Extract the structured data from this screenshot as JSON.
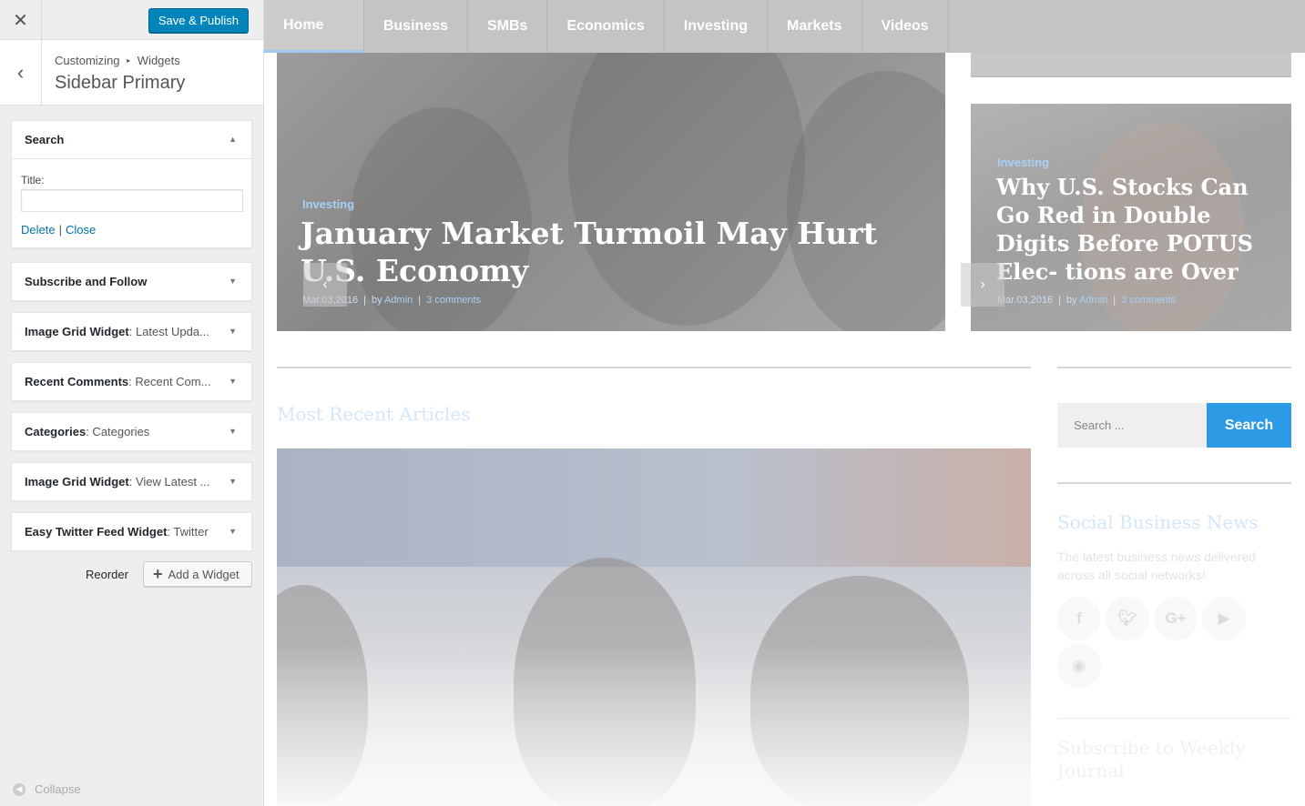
{
  "customizer": {
    "publish_label": "Save & Publish",
    "close_glyph": "✕",
    "back_glyph": "‹",
    "breadcrumb": {
      "root": "Customizing",
      "separator": "▸",
      "current": "Widgets"
    },
    "section_title": "Sidebar Primary",
    "expanded_widget": {
      "title": "Search",
      "field_label": "Title:",
      "field_value": "",
      "delete_label": "Delete",
      "separator": "|",
      "close_label": "Close"
    },
    "widgets": [
      {
        "name": "Subscribe and Follow",
        "sub": ""
      },
      {
        "name": "Image Grid Widget",
        "sub": ": Latest Upda..."
      },
      {
        "name": "Recent Comments",
        "sub": ": Recent Com..."
      },
      {
        "name": "Categories",
        "sub": ": Categories"
      },
      {
        "name": "Image Grid Widget",
        "sub": ": View Latest ..."
      },
      {
        "name": "Easy Twitter Feed Widget",
        "sub": ": Twitter"
      }
    ],
    "reorder_label": "Reorder",
    "add_widget_label": "Add a Widget",
    "collapse_label": "Collapse",
    "accent_color": "#0085ba",
    "link_color": "#0073aa"
  },
  "preview": {
    "nav": [
      "Home",
      "Business",
      "SMBs",
      "Economics",
      "Investing",
      "Markets",
      "Videos"
    ],
    "hero_main": {
      "category": "Investing",
      "title": "January Market Turmoil May Hurt U.S. Economy",
      "date": "Mar.03,2016",
      "by": "by",
      "author": "Admin",
      "comments": "3 comments"
    },
    "hero_side": {
      "category": "Investing",
      "title": "Why U.S. Stocks Can Go Red in Double Digits Before POTUS Elec- tions are Over",
      "date": "Mar.03,2016",
      "by": "by",
      "author": "Admin",
      "comments": "3 comments"
    },
    "recent_title": "Most Recent Articles",
    "search_placeholder": "Search ...",
    "search_button": "Search",
    "social_title": "Social Business News",
    "social_desc": "The latest business news delivered across all social networks!",
    "social_icons": [
      "f",
      "t",
      "G+",
      "yt",
      "rss"
    ],
    "subscribe_title": "Subscribe to Weekly Journal",
    "search_accent": "#2d9ae6"
  }
}
